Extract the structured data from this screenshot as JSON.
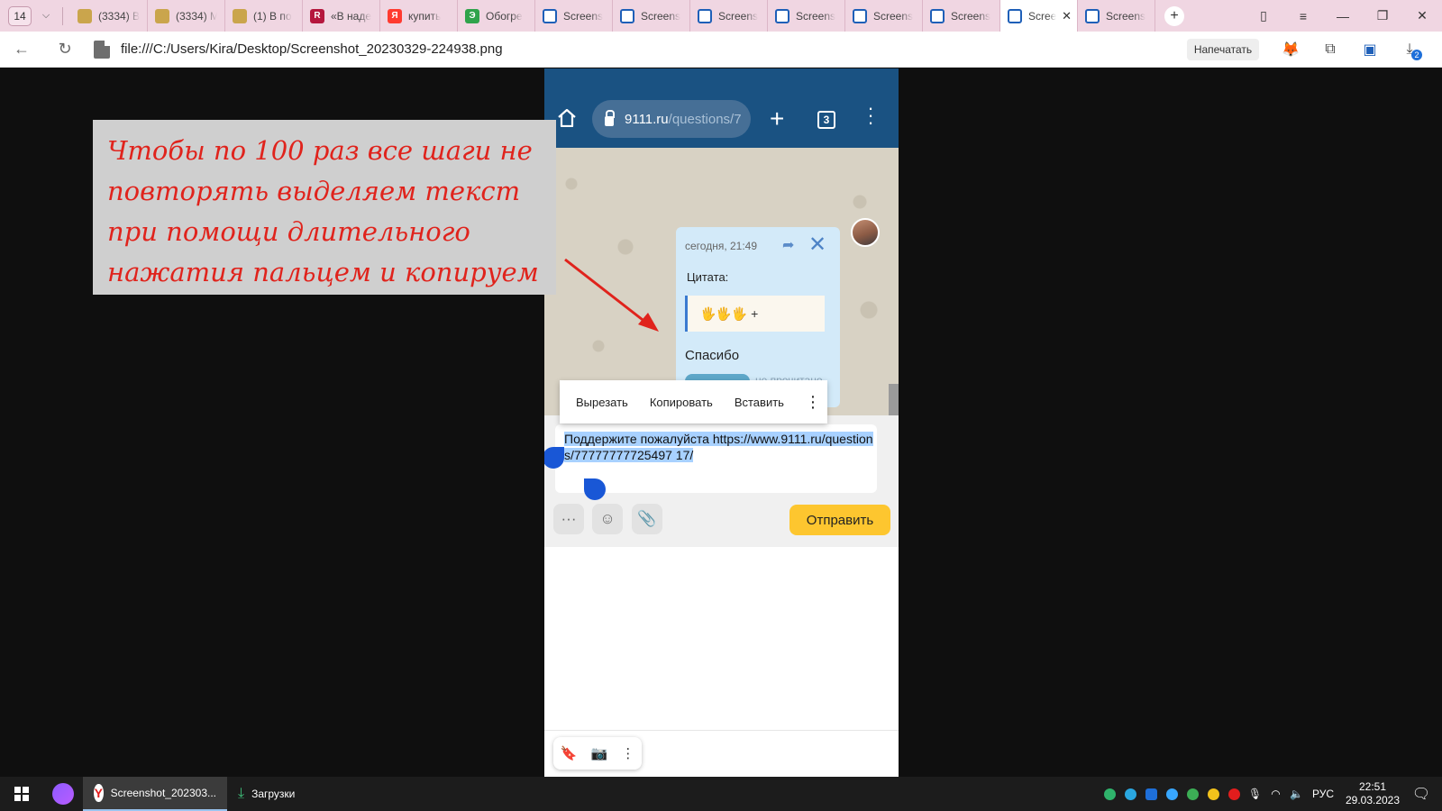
{
  "tabstrip": {
    "tab_count": "14",
    "tabs": [
      {
        "title": "(3334) В",
        "icon": "shield-icon",
        "active": false
      },
      {
        "title": "(3334) М",
        "icon": "shield-icon",
        "active": false
      },
      {
        "title": "(1) В по",
        "icon": "shield-icon",
        "active": false
      },
      {
        "title": "«В наде",
        "icon": "r-logo-icon",
        "active": false
      },
      {
        "title": "купить",
        "icon": "yandex-icon",
        "active": false
      },
      {
        "title": "Обогре",
        "icon": "green-logo-icon",
        "active": false
      },
      {
        "title": "Screens",
        "icon": "screenshot-icon",
        "active": false
      },
      {
        "title": "Screens",
        "icon": "screenshot-icon",
        "active": false
      },
      {
        "title": "Screens",
        "icon": "screenshot-icon",
        "active": false
      },
      {
        "title": "Screens",
        "icon": "screenshot-icon",
        "active": false
      },
      {
        "title": "Screens",
        "icon": "screenshot-icon",
        "active": false
      },
      {
        "title": "Screens",
        "icon": "screenshot-icon",
        "active": false
      },
      {
        "title": "Scree",
        "icon": "screenshot-icon",
        "active": true
      },
      {
        "title": "Screens",
        "icon": "screenshot-icon",
        "active": false
      }
    ],
    "favicon_letters": {
      "r": "R",
      "ya": "Я",
      "green": "Э"
    }
  },
  "addressbar": {
    "url": "file:///C:/Users/Kira/Desktop/Screenshot_20230329-224938.png",
    "print_label": "Напечатать",
    "downloads_badge": "2"
  },
  "phone": {
    "url_host": "9111.ru",
    "url_path": "/questions/7",
    "tabs_count": "3",
    "bubble": {
      "time": "сегодня, 21:49",
      "quote_label": "Цитата:",
      "quote_text": "🖐🖐🖐 +",
      "message": "Спасибо",
      "unread": "не прочитано"
    },
    "context_menu": {
      "cut": "Вырезать",
      "copy": "Копировать",
      "paste": "Вставить"
    },
    "input_text": "Поддержите пожалуйста https://www.9111.ru/questions/77777777725497 17/",
    "send_label": "Отправить"
  },
  "annotation": {
    "text": "Чтобы по 100 раз все шаги не повторять выделяем текст при помощи длительного нажатия пальцем и копируем",
    "color": "#e0231c"
  },
  "taskbar": {
    "apps": [
      {
        "label": "Screenshot_202303...",
        "active": true
      },
      {
        "label": "Загрузки",
        "active": false
      }
    ],
    "lang": "РУС",
    "time": "22:51",
    "date": "29.03.2023"
  }
}
